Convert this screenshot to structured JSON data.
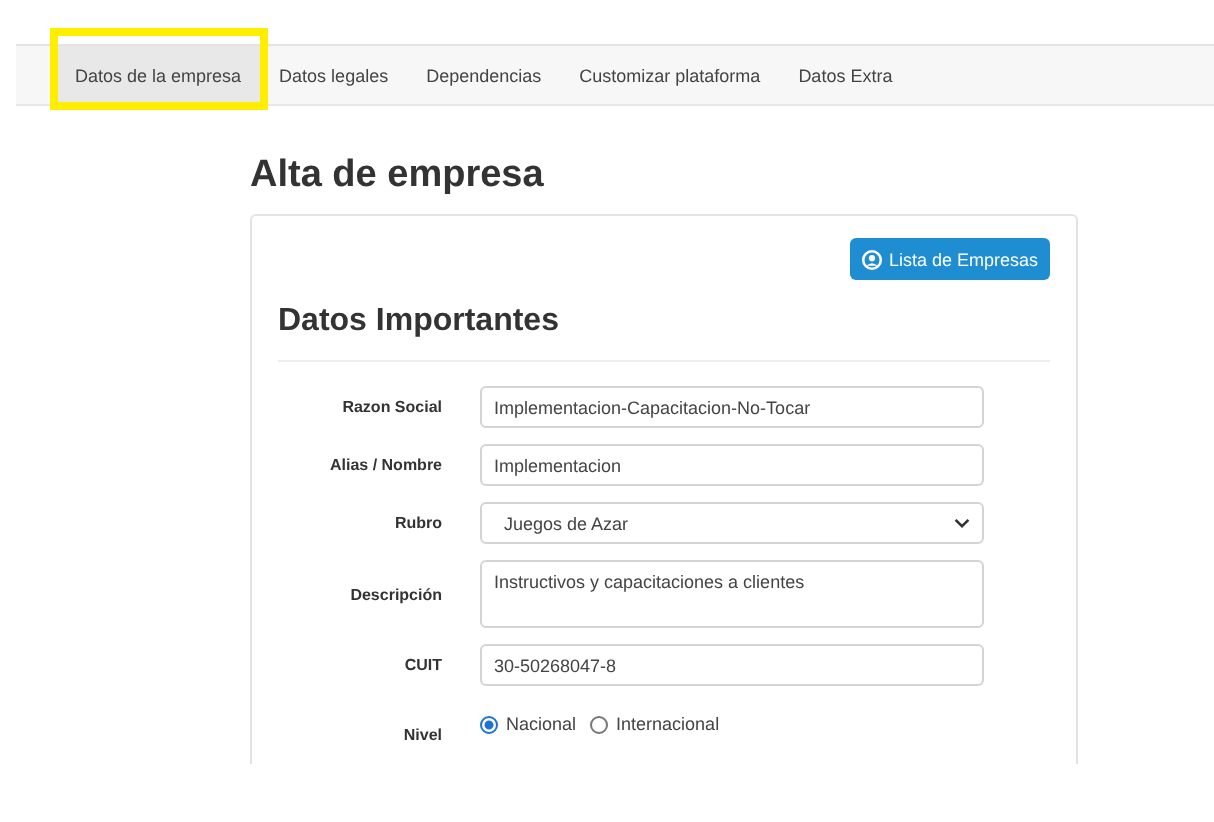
{
  "tabs": [
    {
      "label": "Datos de la empresa",
      "selected": true,
      "highlighted": true
    },
    {
      "label": "Datos legales",
      "selected": false,
      "highlighted": false
    },
    {
      "label": "Dependencias",
      "selected": false,
      "highlighted": false
    },
    {
      "label": "Customizar plataforma",
      "selected": false,
      "highlighted": false
    },
    {
      "label": "Datos Extra",
      "selected": false,
      "highlighted": false
    }
  ],
  "page_title": "Alta de empresa",
  "list_button": "Lista de Empresas",
  "section_title": "Datos Importantes",
  "fields": [
    {
      "kind": "text",
      "label": "Razon Social",
      "value": "Implementacion-Capacitacion-No-Tocar"
    },
    {
      "kind": "text",
      "label": "Alias / Nombre",
      "value": "Implementacion"
    },
    {
      "kind": "select",
      "label": "Rubro",
      "value": "Juegos de Azar"
    },
    {
      "kind": "textarea",
      "label": "Descripción",
      "value": "Instructivos y capacitaciones a clientes"
    },
    {
      "kind": "text",
      "label": "CUIT",
      "value": "30-50268047-8"
    },
    {
      "kind": "radio",
      "label": "Nivel",
      "options": [
        {
          "label": "Nacional",
          "selected": true
        },
        {
          "label": "Internacional",
          "selected": false
        }
      ]
    }
  ]
}
